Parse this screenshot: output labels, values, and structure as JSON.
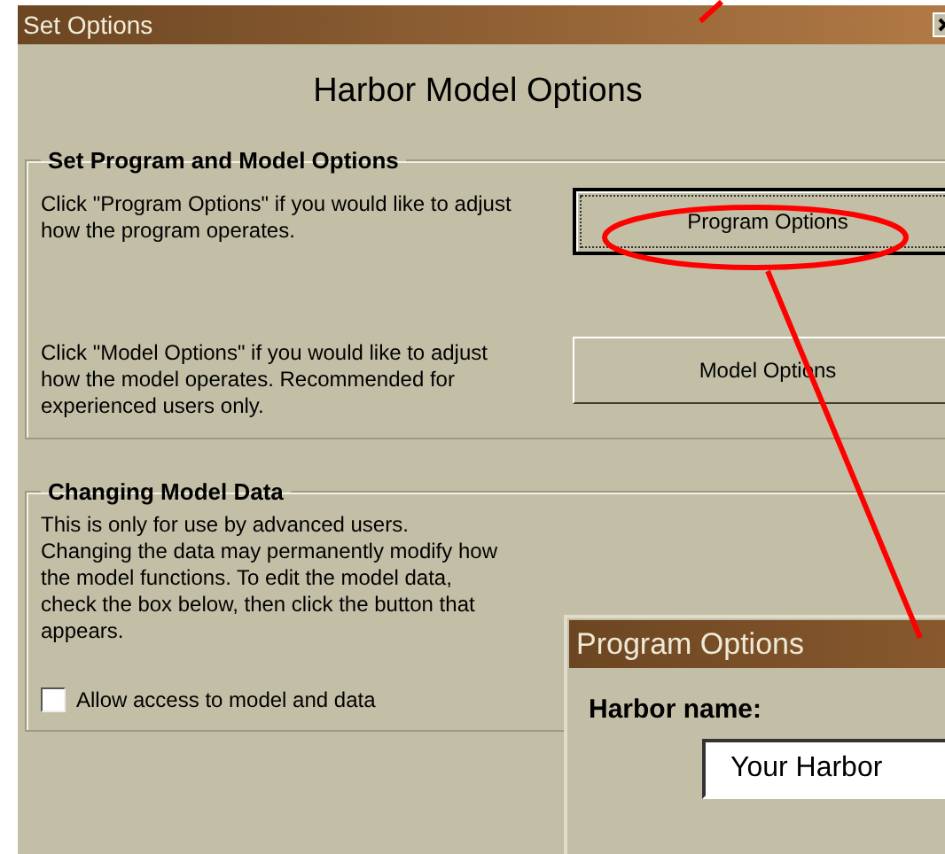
{
  "window": {
    "title": "Set Options"
  },
  "heading": "Harbor Model Options",
  "groups": [
    {
      "kind": "actions",
      "title": "Set Program and Model Options",
      "rows": [
        {
          "text": "Click \"Program Options\" if you would like to adjust how the program operates.",
          "button": {
            "label": "Program Options",
            "default": true
          }
        },
        {
          "text": "Click \"Model Options\" if you would like to adjust how the model operates. Recommended for experienced users only.",
          "button": {
            "label": "Model Options",
            "default": false
          }
        }
      ]
    },
    {
      "kind": "notice",
      "title": "Changing Model Data",
      "text": "This is only for use by advanced users. Changing the data may permanently modify how the model functions. To edit the model data, check the box below, then click the button that appears.",
      "checkbox": {
        "label": "Allow access to model and data",
        "checked": false
      }
    }
  ],
  "overlay_window": {
    "title": "Program Options",
    "field_label": "Harbor name:",
    "field_value": "Your Harbor"
  }
}
